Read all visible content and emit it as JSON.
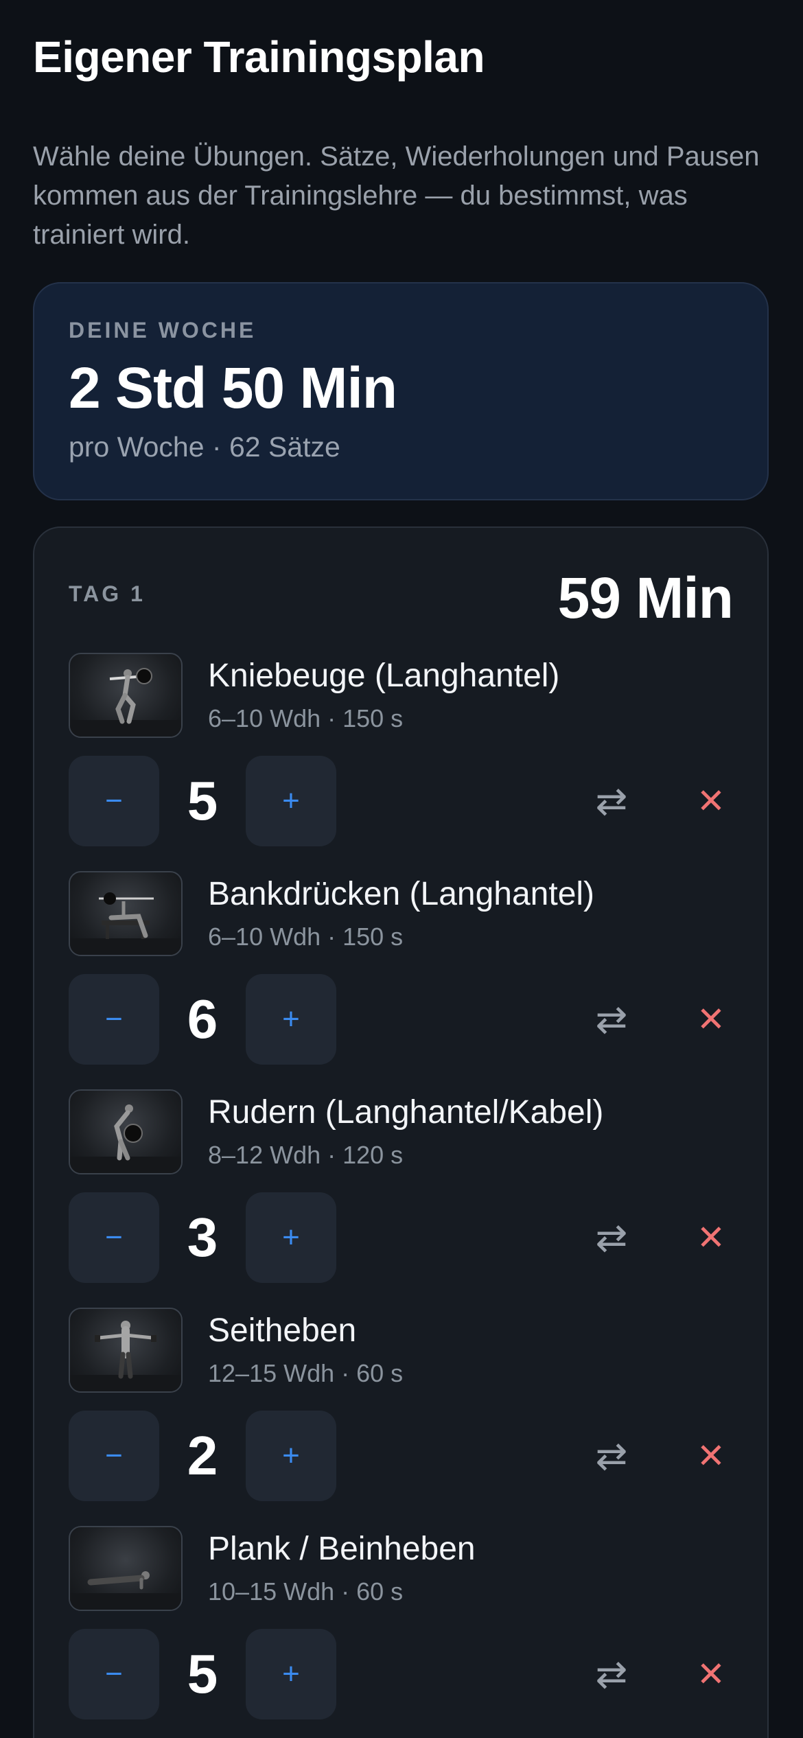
{
  "header": {
    "title": "Eigener Trainingsplan",
    "intro": "Wähle deine Übungen. Sätze, Wiederholungen und Pausen kommen aus der Trainingslehre — du bestimmst, was trainiert wird."
  },
  "week": {
    "label": "DEINE WOCHE",
    "total": "2 Std 50 Min",
    "subtitle": "pro Woche · 62 Sätze"
  },
  "day": {
    "label": "TAG 1",
    "total": "59 Min",
    "controls": {
      "minus": "−",
      "plus": "+",
      "swap": "⇄",
      "remove": "✕"
    },
    "exercises": [
      {
        "name": "Kniebeuge (Langhantel)",
        "meta": "6–10 Wdh · 150 s",
        "sets": "5",
        "thumbnail": "squat-photo"
      },
      {
        "name": "Bankdrücken (Langhantel)",
        "meta": "6–10 Wdh · 150 s",
        "sets": "6",
        "thumbnail": "bench-press-photo"
      },
      {
        "name": "Rudern (Langhantel/Kabel)",
        "meta": "8–12 Wdh · 120 s",
        "sets": "3",
        "thumbnail": "row-photo"
      },
      {
        "name": "Seitheben",
        "meta": "12–15 Wdh · 60 s",
        "sets": "2",
        "thumbnail": "lateral-raise-photo"
      },
      {
        "name": "Plank / Beinheben",
        "meta": "10–15 Wdh · 60 s",
        "sets": "5",
        "thumbnail": "plank-photo"
      }
    ]
  },
  "colors": {
    "background": "#0d1117",
    "accent": "#3b8bf0",
    "remove": "#f07373",
    "week_card": "#142136",
    "day_card": "#161b22"
  }
}
